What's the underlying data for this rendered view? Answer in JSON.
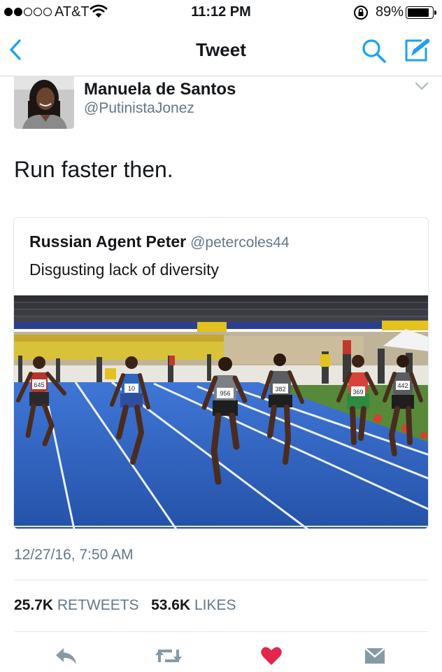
{
  "status_bar": {
    "carrier": "AT&T",
    "time": "11:12 PM",
    "battery": "89%",
    "battery_level": 0.89,
    "signal_bars_filled": 2,
    "signal_bars_total": 5
  },
  "nav": {
    "title": "Tweet",
    "icons": [
      "back-chevron-icon",
      "search-icon",
      "compose-icon"
    ]
  },
  "tweet": {
    "author_name": "Manuela de Santos",
    "author_handle": "@PutinistaJonez",
    "text": "Run faster then.",
    "timestamp": "12/27/16, 7:50 AM",
    "retweets_count": "25.7K",
    "retweets_label": "RETWEETS",
    "likes_count": "53.6K",
    "likes_label": "LIKES"
  },
  "quoted_tweet": {
    "author_name": "Russian Agent Peter",
    "author_handle": "@petercoles44",
    "text": "Disgusting lack of diversity",
    "bibs": [
      "645",
      "10",
      "956",
      "382",
      "369",
      "442"
    ]
  },
  "actions": [
    "reply-icon",
    "retweet-icon",
    "like-icon",
    "message-icon"
  ],
  "colors": {
    "accent": "#1da1f2",
    "like": "#e2264d",
    "secondary_text": "#657786",
    "track_blue": "#2f66c8"
  }
}
